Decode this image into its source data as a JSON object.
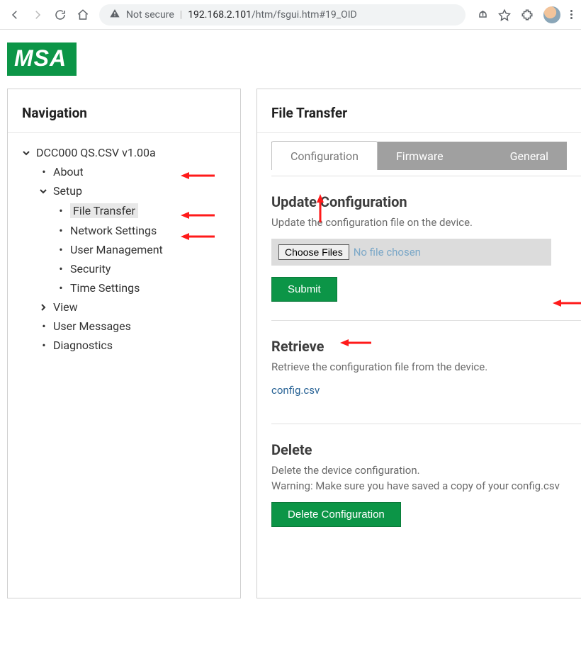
{
  "chrome": {
    "not_secure": "Not secure",
    "url_host": "192.168.2.101",
    "url_path": "/htm/fsgui.htm#19_OID"
  },
  "logo": {
    "text": "MSA"
  },
  "nav": {
    "title": "Navigation",
    "root": "DCC000 QS.CSV v1.00a",
    "about": "About",
    "setup": "Setup",
    "file_transfer": "File Transfer",
    "network_settings": "Network Settings",
    "user_management": "User Management",
    "security": "Security",
    "time_settings": "Time Settings",
    "view": "View",
    "user_messages": "User Messages",
    "diagnostics": "Diagnostics"
  },
  "main": {
    "title": "File Transfer",
    "tabs": {
      "configuration": "Configuration",
      "firmware": "Firmware",
      "general": "General"
    },
    "update": {
      "heading": "Update Configuration",
      "desc": "Update the configuration file on the device.",
      "choose": "Choose Files",
      "placeholder": "No file chosen",
      "submit": "Submit"
    },
    "retrieve": {
      "heading": "Retrieve",
      "desc": "Retrieve the configuration file from the device.",
      "link": "config.csv"
    },
    "delete": {
      "heading": "Delete",
      "desc1": "Delete the device configuration.",
      "desc2": "Warning: Make sure you have saved a copy of your config.csv",
      "button": "Delete Configuration"
    }
  }
}
